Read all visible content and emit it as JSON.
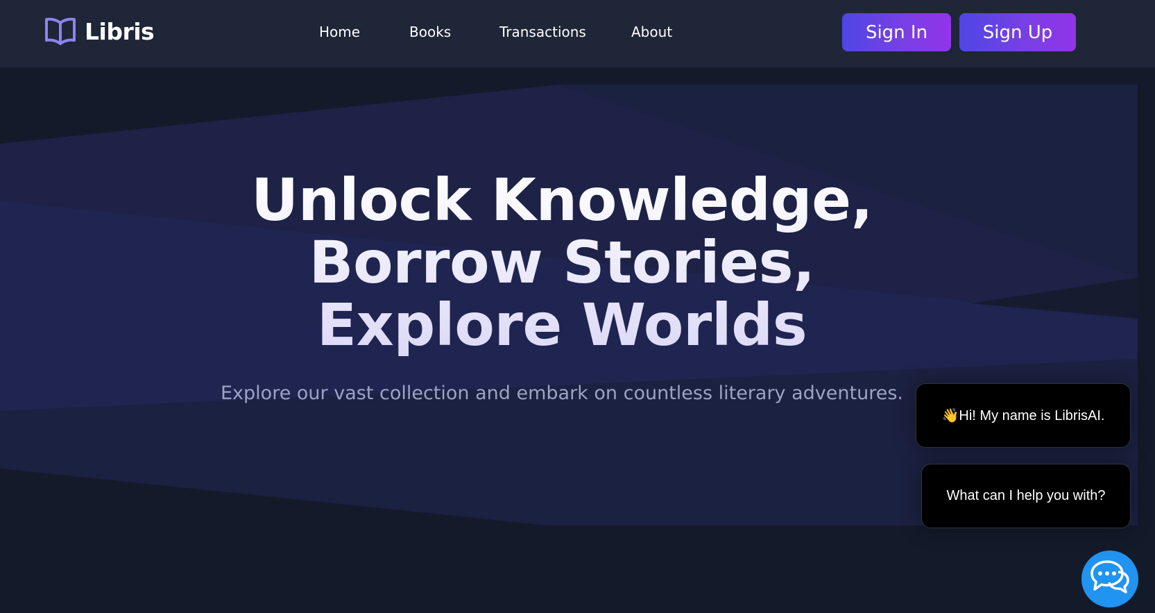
{
  "brand": {
    "name": "Libris",
    "icon": "open-book-icon"
  },
  "nav": {
    "items": [
      {
        "label": "Home"
      },
      {
        "label": "Books"
      },
      {
        "label": "Transactions"
      },
      {
        "label": "About"
      }
    ]
  },
  "auth": {
    "sign_in": "Sign In",
    "sign_up": "Sign Up"
  },
  "hero": {
    "title": "Unlock Knowledge, Borrow Stories, Explore Worlds",
    "subtitle": "Explore our vast collection and embark on countless literary adventures."
  },
  "chat": {
    "greeting": "👋Hi! My name is LibrisAI.",
    "prompt": "What can I help you with?",
    "button_icon": "chat-bubbles-icon"
  },
  "colors": {
    "header_bg": "#1e2637",
    "page_bg": "#131a2a",
    "accent_start": "#4f46e5",
    "accent_end": "#9333ea",
    "chat_button": "#2193f0"
  }
}
